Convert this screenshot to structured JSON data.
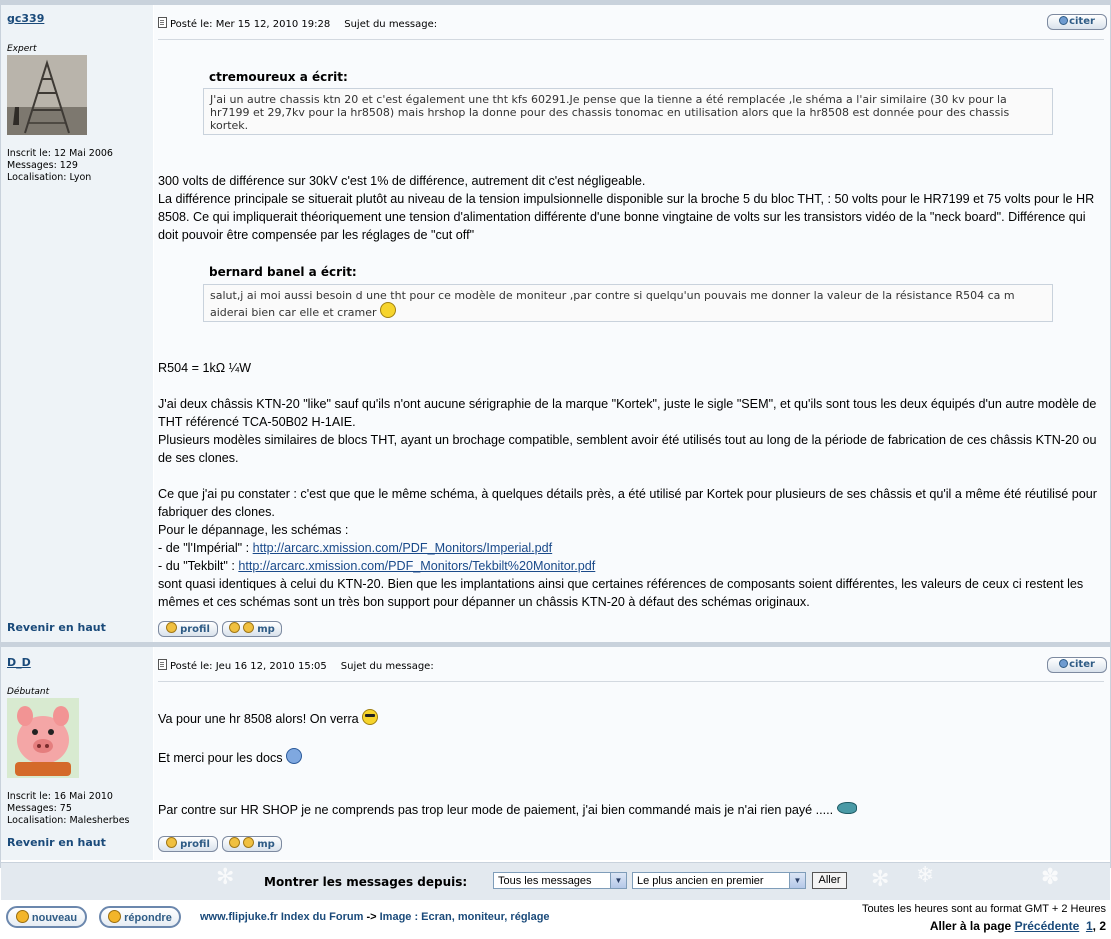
{
  "posts": [
    {
      "author": {
        "username": "gc339",
        "rank": "Expert",
        "avatar_icon": "radio-tower-avatar",
        "joined": "Inscrit le: 12 Mai 2006",
        "messages": "Messages: 129",
        "location": "Localisation: Lyon"
      },
      "posted": "Posté le: Mer 15 12, 2010 19:28",
      "subject_label": "Sujet du message:",
      "quote_button": "citer",
      "quotes": [
        {
          "author": "ctremoureux a écrit:",
          "text": "J'ai un autre chassis ktn 20 et c'est également une tht kfs 60291.Je pense que la tienne a été remplacée ,le shéma a l'air similaire (30 kv pour la hr7199 et 29,7kv pour la hr8508) mais hrshop la donne pour des chassis tonomac en utilisation alors que la hr8508 est donnée pour des chassis kortek."
        },
        {
          "author": "bernard banel a écrit:",
          "text": "salut,j ai moi aussi besoin d une tht pour ce modèle de moniteur ,par contre si quelqu'un pouvais me donner la valeur de la résistance R504 ca m aiderai bien car elle et cramer"
        }
      ],
      "paragraphs": {
        "p1": "300 volts de différence sur 30kV c'est 1% de différence, autrement dit c'est négligeable.",
        "p2": "La différence principale se situerait plutôt au niveau de la tension impulsionnelle disponible sur la broche 5 du bloc THT, : 50 volts pour le HR7199 et 75 volts pour le HR 8508. Ce qui impliquerait théoriquement une tension d'alimentation différente d'une bonne vingtaine de volts sur les transistors vidéo de la \"neck board\". Différence qui doit pouvoir être compensée par les réglages de \"cut off\"",
        "p3": "R504 = 1kΩ ¼W",
        "p4": "J'ai deux châssis KTN-20 \"like\" sauf qu'ils n'ont aucune sérigraphie de la marque \"Kortek\", juste le sigle \"SEM\", et qu'ils sont tous les deux équipés d'un autre modèle de THT référencé TCA-50B02 H-1AIE.",
        "p5": "Plusieurs modèles similaires de blocs THT, ayant un brochage compatible, semblent avoir été utilisés tout au long de la période de fabrication de ces châssis KTN-20 ou de ses clones.",
        "p6": "Ce que j'ai pu constater : c'est que que le même schéma, à quelques détails près, a été utilisé par Kortek pour plusieurs de ses châssis et qu'il a même été réutilisé pour fabriquer des clones.",
        "p7": "Pour le dépannage, les schémas :",
        "p8_prefix": "- de \"l'Impérial\" : ",
        "p8_link": "http://arcarc.xmission.com/PDF_Monitors/Imperial.pdf",
        "p9_prefix": "- du \"Tekbilt\" : ",
        "p9_link": "http://arcarc.xmission.com/PDF_Monitors/Tekbilt%20Monitor.pdf",
        "p10": "sont quasi identiques à celui du KTN-20. Bien que les implantations ainsi que certaines références de composants soient différentes, les valeurs de ceux ci restent les mêmes et ces schémas sont un très bon support pour dépanner un châssis KTN-20 à défaut des schémas originaux."
      },
      "back_to_top": "Revenir en haut",
      "profile_button": "profil",
      "pm_button": "mp"
    },
    {
      "author": {
        "username": "D_D",
        "rank": "Débutant",
        "avatar_icon": "pig-avatar",
        "joined": "Inscrit le: 16 Mai 2010",
        "messages": "Messages: 75",
        "location": "Localisation: Malesherbes"
      },
      "posted": "Posté le: Jeu 16 12, 2010 15:05",
      "subject_label": "Sujet du message:",
      "quote_button": "citer",
      "paragraphs": {
        "p1": "Va pour une hr 8508 alors! On verra",
        "p2": "Et merci pour les docs",
        "p3": "Par contre sur HR SHOP je ne comprends pas trop leur mode de paiement, j'ai bien commandé mais je n'ai rien payé ....."
      },
      "back_to_top": "Revenir en haut",
      "profile_button": "profil",
      "pm_button": "mp"
    }
  ],
  "filter": {
    "label": "Montrer les messages depuis:",
    "period_value": "Tous les messages",
    "order_value": "Le plus ancien en premier",
    "go_button": "Aller"
  },
  "footer": {
    "new_button": "nouveau",
    "reply_button": "répondre",
    "nav_home": "www.flipjuke.fr Index du Forum",
    "nav_sep": "->",
    "nav_forum": "Image : Ecran, moniteur, réglage",
    "timezone": "Toutes les heures sont au format GMT + 2 Heures",
    "pager_label": "Aller à la page",
    "pager_prev": "Précédente",
    "pager_page1": "1",
    "pager_sep": ",",
    "pager_page2": "2"
  }
}
